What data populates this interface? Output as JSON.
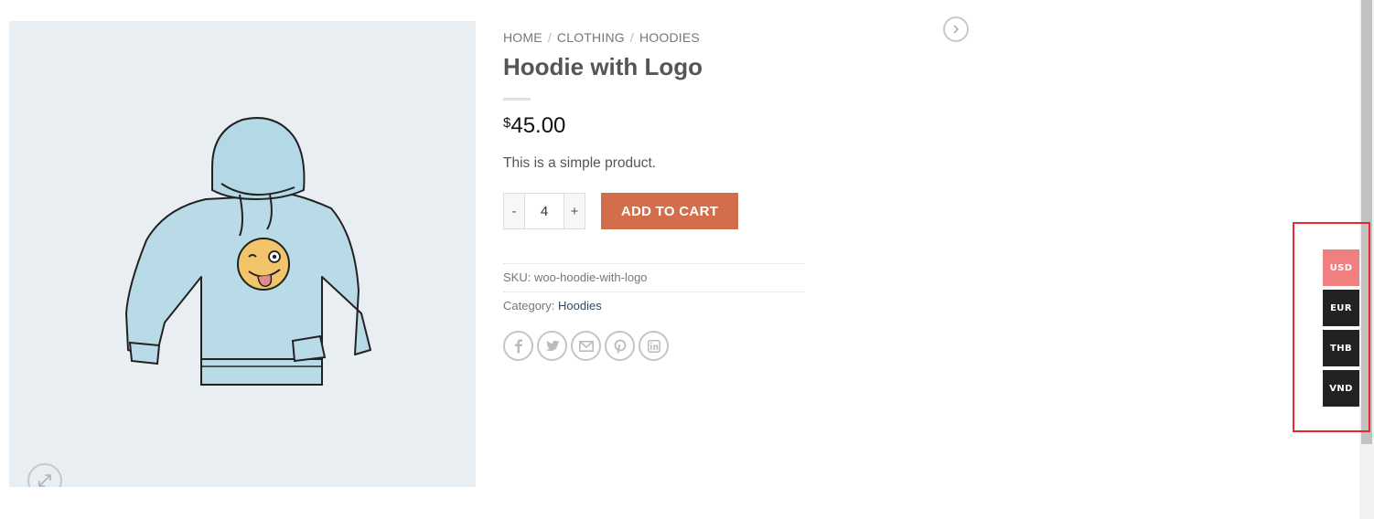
{
  "breadcrumb": {
    "items": [
      "HOME",
      "CLOTHING",
      "HOODIES"
    ],
    "separator": "/"
  },
  "product": {
    "title": "Hoodie with Logo",
    "currency_symbol": "$",
    "price": "45.00",
    "short_description": "This is a simple product.",
    "quantity": "4",
    "qty_minus_label": "-",
    "qty_plus_label": "+",
    "add_to_cart_label": "ADD TO CART",
    "sku_label": "SKU:",
    "sku_value": "woo-hoodie-with-logo",
    "category_label": "Category:",
    "category_value": "Hoodies"
  },
  "share_icons": [
    "facebook-icon",
    "twitter-icon",
    "email-icon",
    "pinterest-icon",
    "linkedin-icon"
  ],
  "currency_switcher": {
    "options": [
      "USD",
      "EUR",
      "THB",
      "VND"
    ],
    "active": "USD",
    "active_color": "#f08080",
    "inactive_color": "#222222"
  },
  "colors": {
    "accent": "#d26e4b",
    "image_bg": "#e9eef2",
    "highlight_border": "#e8282e"
  }
}
